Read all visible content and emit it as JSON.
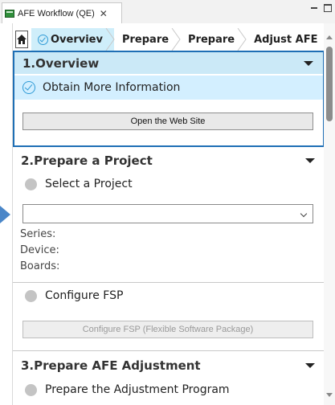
{
  "view_tab": {
    "title": "AFE Workflow (QE)",
    "close": "✕"
  },
  "breadcrumb": {
    "items": [
      {
        "label": "Overviev",
        "active": true
      },
      {
        "label": "Prepare"
      },
      {
        "label": "Prepare"
      },
      {
        "label": "Adjust AFE"
      }
    ]
  },
  "overview": {
    "header": "1.Overview",
    "step_label": "Obtain More Information",
    "button_label": "Open the Web Site"
  },
  "prepare_project": {
    "header": "2.Prepare a Project",
    "select_project_label": "Select a Project",
    "project_combo_value": "",
    "series_label": "Series:",
    "device_label": "Device:",
    "boards_label": "Boards:",
    "configure_fsp_label": "Configure FSP",
    "configure_fsp_button": "Configure FSP (Flexible Software Package)"
  },
  "prepare_afe": {
    "header": "3.Prepare AFE Adjustment",
    "step_label": "Prepare the Adjustment Program"
  },
  "colors": {
    "accent_border": "#1f6fb5",
    "highlight_bg": "#d3efff",
    "check_blue": "#2e9ad6",
    "pending_dot": "#c4c4c4"
  }
}
